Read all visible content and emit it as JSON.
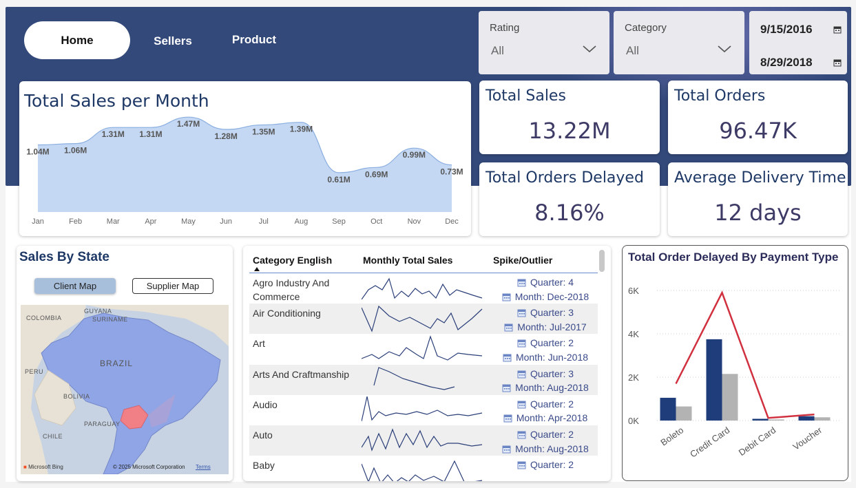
{
  "nav": {
    "home": "Home",
    "sellers": "Sellers",
    "product": "Product"
  },
  "filters": {
    "rating": {
      "label": "Rating",
      "value": "All"
    },
    "category": {
      "label": "Category",
      "value": "All"
    },
    "date_start": "9/15/2016",
    "date_end": "8/29/2018"
  },
  "kpis": {
    "total_sales": {
      "title": "Total Sales",
      "value": "13.22M"
    },
    "total_orders": {
      "title": "Total Orders",
      "value": "96.47K"
    },
    "orders_delayed": {
      "title": "Total Orders Delayed",
      "value": "8.16%"
    },
    "avg_delivery": {
      "title": "Average Delivery Time",
      "value": "12 days"
    }
  },
  "sales_by_state": {
    "title": "Sales By State",
    "client_btn": "Client Map",
    "supplier_btn": "Supplier Map",
    "labels": [
      "COLOMBIA",
      "GUYANA",
      "SURINAME",
      "BRAZIL",
      "PERU",
      "BOLIVIA",
      "PARAGUAY",
      "CHILE"
    ],
    "credit": "Microsoft Bing",
    "copyright": "© 2025 Microsoft Corporation",
    "terms": "Terms"
  },
  "category_table": {
    "headers": [
      "Category English",
      "Monthly Total Sales",
      "Spike/Outlier"
    ],
    "rows": [
      {
        "category": "Agro Industry And Commerce",
        "quarter": "Quarter: 4",
        "month": "Month: Dec-2018"
      },
      {
        "category": "Air Conditioning",
        "quarter": "Quarter: 3",
        "month": "Month: Jul-2017"
      },
      {
        "category": "Art",
        "quarter": "Quarter: 2",
        "month": "Month: Jun-2018"
      },
      {
        "category": "Arts And Craftmanship",
        "quarter": "Quarter: 3",
        "month": "Month: Aug-2018"
      },
      {
        "category": "Audio",
        "quarter": "Quarter: 2",
        "month": "Month: Apr-2018"
      },
      {
        "category": "Auto",
        "quarter": "Quarter: 2",
        "month": "Month: Aug-2018"
      },
      {
        "category": "Baby",
        "quarter": "Quarter: 2",
        "month": ""
      }
    ]
  },
  "chart_data": [
    {
      "type": "area",
      "title": "Total Sales per Month",
      "categories": [
        "Jan",
        "Feb",
        "Mar",
        "Apr",
        "May",
        "Jun",
        "Jul",
        "Aug",
        "Sep",
        "Oct",
        "Nov",
        "Dec"
      ],
      "values": [
        1.04,
        1.06,
        1.31,
        1.31,
        1.47,
        1.28,
        1.35,
        1.39,
        0.61,
        0.69,
        0.99,
        0.73
      ],
      "data_labels": [
        "1.04M",
        "1.06M",
        "1.31M",
        "1.31M",
        "1.47M",
        "1.28M",
        "1.35M",
        "1.39M",
        "0.61M",
        "0.69M",
        "0.99M",
        "0.73M"
      ],
      "color": "#c5d8f3"
    },
    {
      "type": "bar",
      "title": "Total Order Delayed By Payment Type",
      "categories": [
        "Boleto",
        "Credit Card",
        "Debit Card",
        "Voucher"
      ],
      "series": [
        {
          "values": [
            1050,
            3750,
            80,
            200
          ],
          "color": "#1f3d7a"
        },
        {
          "values": [
            650,
            2150,
            50,
            150
          ],
          "color": "#b3b3b3"
        }
      ],
      "line": {
        "values": [
          1700,
          5900,
          120,
          280
        ],
        "color": "#d1303f"
      },
      "yticks": [
        "0K",
        "2K",
        "4K",
        "6K"
      ],
      "ylim": [
        0,
        6000
      ],
      "grid": true
    }
  ],
  "colors": {
    "banner": "#33497a",
    "accent": "#1e3866",
    "highlight_state": "#f07f86",
    "map_fill": "#8fa5e6"
  }
}
